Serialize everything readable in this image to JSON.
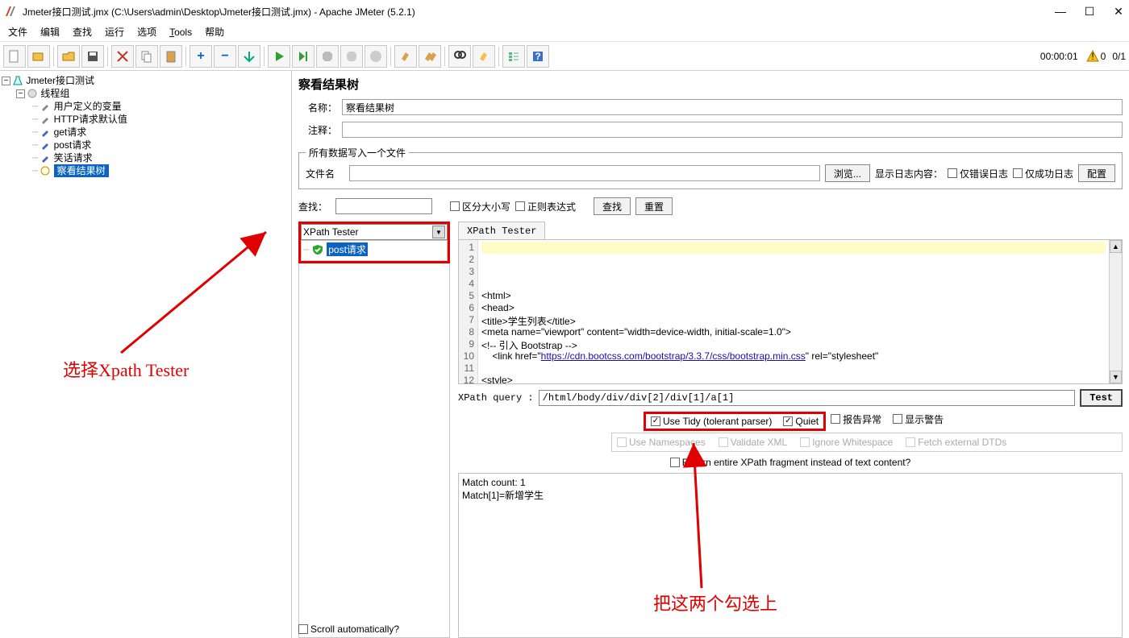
{
  "window": {
    "title": "Jmeter接口测试.jmx (C:\\Users\\admin\\Desktop\\Jmeter接口测试.jmx) - Apache JMeter (5.2.1)"
  },
  "menu": {
    "file": "文件",
    "edit": "编辑",
    "search": "查找",
    "run": "运行",
    "options": "选项",
    "tools": "Tools",
    "help": "帮助"
  },
  "toolbar": {
    "timer": "00:00:01",
    "warn_count": "0",
    "thread_label": "0/1"
  },
  "tree": {
    "root": "Jmeter接口测试",
    "thread_group": "线程组",
    "items": [
      "用户定义的变量",
      "HTTP请求默认值",
      "get请求",
      "post请求",
      "笑话请求",
      "察看结果树"
    ],
    "selected": "察看结果树"
  },
  "panel": {
    "title": "察看结果树",
    "name_label": "名称：",
    "name_value": "察看结果树",
    "comment_label": "注释：",
    "comment_value": "",
    "file_legend": "所有数据写入一个文件",
    "file_label": "文件名",
    "file_value": "",
    "browse": "浏览...",
    "display_log": "显示日志内容：",
    "only_error": "仅错误日志",
    "only_success": "仅成功日志",
    "config": "配置",
    "search_label": "查找：",
    "search_value": "",
    "case_sensitive": "区分大小写",
    "regex": "正则表达式",
    "search_btn": "查找",
    "reset_btn": "重置"
  },
  "left_result": {
    "tester_combo": "XPath Tester",
    "item": "post请求"
  },
  "tabs": {
    "xpath_tester": "XPath Tester"
  },
  "code": {
    "lines": [
      "",
      "",
      "",
      "",
      "<html>",
      "<head>",
      "    <title>学生列表</title>",
      "    <meta name=\"viewport\" content=\"width=device-width, initial-scale=1.0\">",
      "    <!-- 引入 Bootstrap -->",
      "    <link href=\"https://cdn.bootcss.com/bootstrap/3.3.7/css/bootstrap.min.css\" rel=\"stylesheet\"",
      "",
      "<style>"
    ],
    "link_text": "https://cdn.bootcss.com/bootstrap/3.3.7/css/bootstrap.min.css"
  },
  "xpath": {
    "label": "XPath query :",
    "value": "/html/body/div/div[2]/div[1]/a[1]",
    "test_btn": "Test",
    "use_tidy": "Use Tidy (tolerant parser)",
    "quiet": "Quiet",
    "report_error": "报告异常",
    "show_warn": "显示警告",
    "use_ns": "Use Namespaces",
    "validate_xml": "Validate XML",
    "ignore_ws": "Ignore Whitespace",
    "fetch_dtd": "Fetch external DTDs",
    "return_frag": "Return entire XPath fragment instead of text content?"
  },
  "match": {
    "count_line": "Match count: 1",
    "line1": "Match[1]=新增学生"
  },
  "scroll_auto": "Scroll automatically?",
  "annot": {
    "a1": "选择Xpath Tester",
    "a2": "把这两个勾选上"
  }
}
